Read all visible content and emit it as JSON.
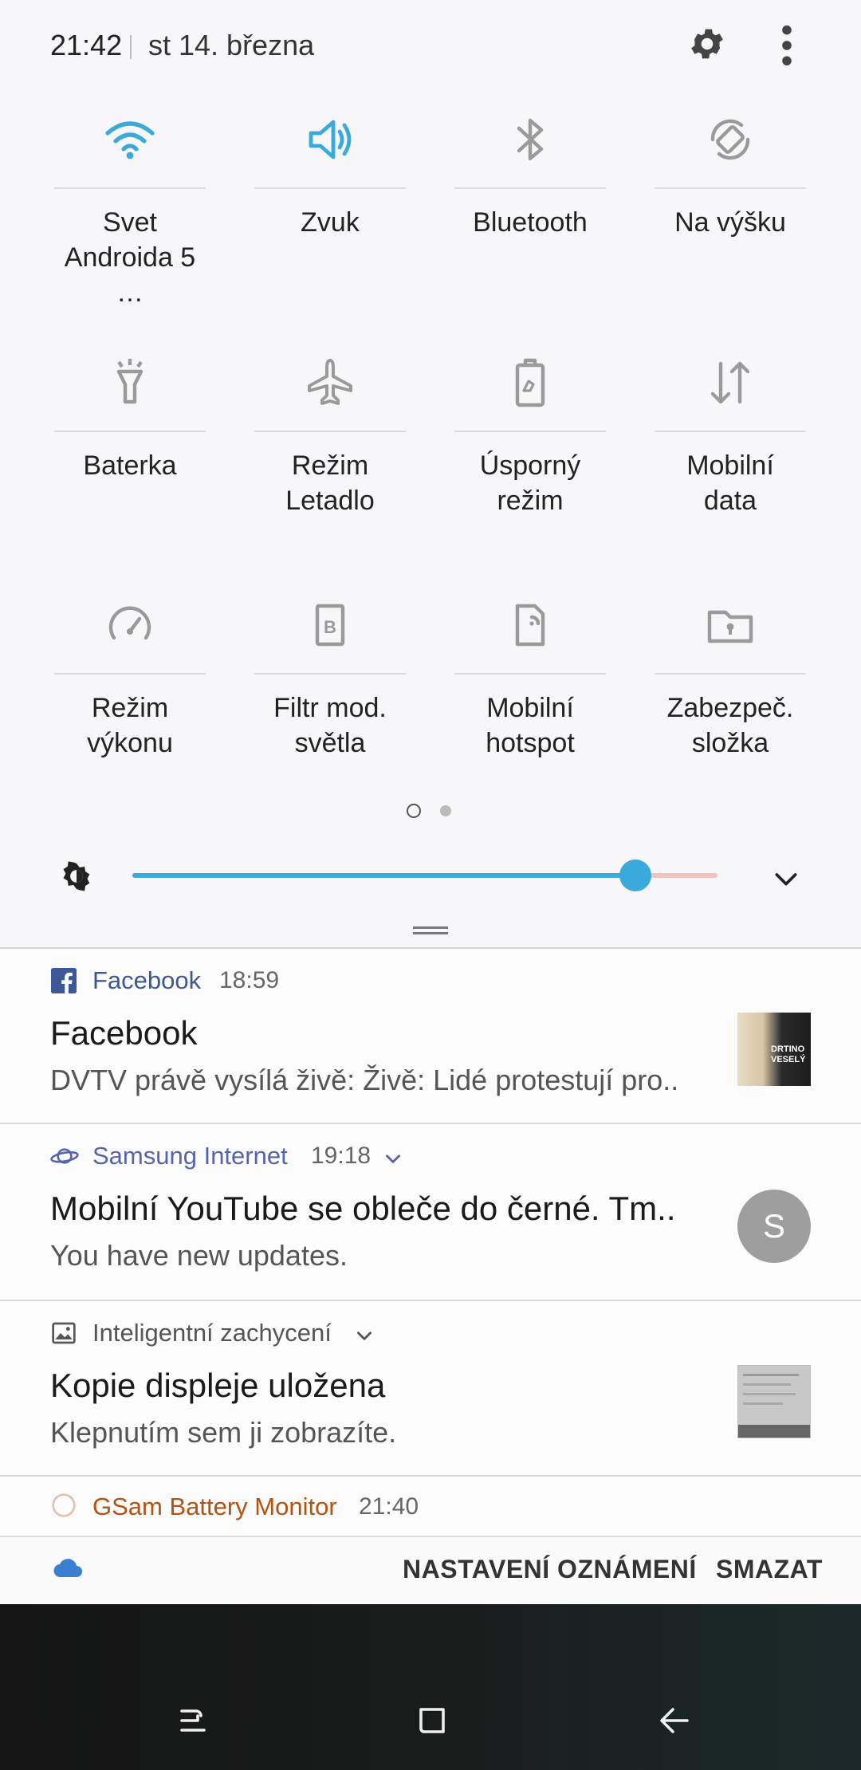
{
  "header": {
    "time": "21:42",
    "date": "st 14. března",
    "settings_icon": "gear-icon",
    "more_icon": "more-vert-icon"
  },
  "tiles": [
    {
      "label": "Svet\nAndroida 5 …",
      "icon": "wifi-icon",
      "active": true
    },
    {
      "label": "Zvuk",
      "icon": "speaker-icon",
      "active": true
    },
    {
      "label": "Bluetooth",
      "icon": "bluetooth-icon",
      "active": false
    },
    {
      "label": "Na výšku",
      "icon": "rotate-icon",
      "active": false
    },
    {
      "label": "Baterka",
      "icon": "flashlight-icon",
      "active": false
    },
    {
      "label": "Režim\nLetadlo",
      "icon": "airplane-icon",
      "active": false
    },
    {
      "label": "Úsporný\nrežim",
      "icon": "battery-saver-icon",
      "active": false
    },
    {
      "label": "Mobilní\ndata",
      "icon": "mobile-data-icon",
      "active": false
    },
    {
      "label": "Režim\nvýkonu",
      "icon": "performance-gauge-icon",
      "active": false
    },
    {
      "label": "Filtr mod.\nsvětla",
      "icon": "blue-light-filter-icon",
      "active": false
    },
    {
      "label": "Mobilní\nhotspot",
      "icon": "hotspot-icon",
      "active": false
    },
    {
      "label": "Zabezpeč.\nsložka",
      "icon": "secure-folder-icon",
      "active": false
    }
  ],
  "pages": {
    "count": 2,
    "current": 1
  },
  "brightness": {
    "level": 0.86,
    "icon": "brightness-icon",
    "expand_icon": "chevron-down-icon"
  },
  "notifications": [
    {
      "app": "Facebook",
      "time": "18:59",
      "title": "Facebook",
      "text": "DVTV právě vysílá živě: Živě: Lidé protestují pro..",
      "app_color": "#3b5998",
      "thumb_text": "DRTINO\nVESELÝ"
    },
    {
      "app": "Samsung Internet",
      "time": "19:18",
      "title": "Mobilní YouTube se obleče do černé. Tm..",
      "text": "You have new updates.",
      "app_color": "#5664b0",
      "avatar": "S"
    },
    {
      "app": "Inteligentní zachycení",
      "title": "Kopie displeje uložena",
      "text": "Klepnutím sem ji zobrazíte.",
      "app_color": "#555555"
    },
    {
      "app": "GSam Battery Monitor",
      "time": "21:40",
      "app_color": "#b5520f"
    }
  ],
  "actions": {
    "notification_settings": "NASTAVENÍ OZNÁMENÍ",
    "clear": "SMAZAT"
  },
  "colors": {
    "accent": "#3aa9dc",
    "inactive_icon": "#9a9a9a"
  }
}
